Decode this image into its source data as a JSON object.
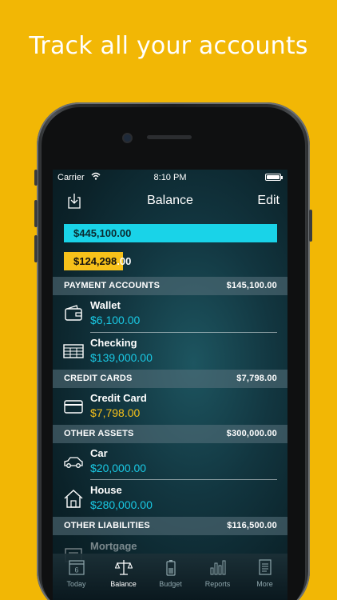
{
  "headline": "Track all your accounts",
  "status": {
    "carrier": "Carrier",
    "time": "8:10 PM"
  },
  "nav": {
    "title": "Balance",
    "edit": "Edit",
    "export_icon": "export-icon"
  },
  "summary": {
    "total_assets": "$445,100.00",
    "total_liabilities_prefix": "$124,298",
    "total_liabilities_suffix": ".00",
    "liabilities_fraction": 0.279
  },
  "sections": [
    {
      "name": "PAYMENT ACCOUNTS",
      "total": "$145,100.00"
    },
    {
      "name": "CREDIT CARDS",
      "total": "$7,798.00"
    },
    {
      "name": "OTHER ASSETS",
      "total": "$300,000.00"
    },
    {
      "name": "OTHER LIABILITIES",
      "total": "$116,500.00"
    }
  ],
  "accounts": [
    {
      "name": "Wallet",
      "amount": "$6,100.00",
      "icon": "wallet-icon"
    },
    {
      "name": "Checking",
      "amount": "$139,000.00",
      "icon": "checking-icon"
    },
    {
      "name": "Credit Card",
      "amount": "$7,798.00",
      "icon": "credit-card-icon"
    },
    {
      "name": "Car",
      "amount": "$20,000.00",
      "icon": "car-icon"
    },
    {
      "name": "House",
      "amount": "$280,000.00",
      "icon": "house-icon"
    },
    {
      "name": "Mortgage",
      "amount": "",
      "icon": "mortgage-icon"
    }
  ],
  "tabs": [
    {
      "label": "Today",
      "icon": "calendar-icon",
      "day": "6"
    },
    {
      "label": "Balance",
      "icon": "scale-icon"
    },
    {
      "label": "Budget",
      "icon": "battery-icon"
    },
    {
      "label": "Reports",
      "icon": "bar-chart-icon"
    },
    {
      "label": "More",
      "icon": "document-icon"
    }
  ],
  "colors": {
    "background": "#f2b705",
    "accent_cyan": "#19d3e8",
    "accent_yellow": "#f6c11a"
  }
}
